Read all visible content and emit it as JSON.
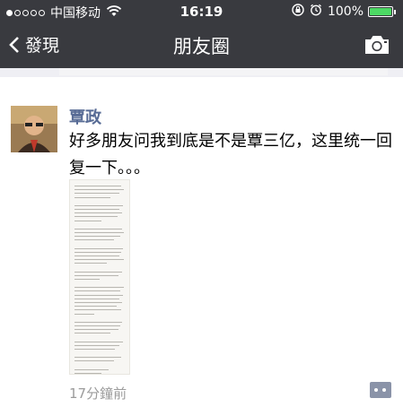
{
  "status_bar": {
    "signal_bars": 5,
    "signal_filled": 1,
    "carrier": "中国移动",
    "time": "16:19",
    "battery_percent": "100%",
    "battery_level": 1.0,
    "battery_color": "#4cd964"
  },
  "nav": {
    "back_label": "發現",
    "title": "朋友圈",
    "camera_icon": "camera-icon"
  },
  "post": {
    "author": "覃政",
    "text": "好多朋友问我到底是不是覃三亿，这里统一回复一下。。。",
    "time_ago": "17分鐘前",
    "comment_icon": "comment-icon"
  },
  "colors": {
    "nav_bg": "#393a3f",
    "author_color": "#576b95",
    "comment_btn": "#8a93a8"
  }
}
